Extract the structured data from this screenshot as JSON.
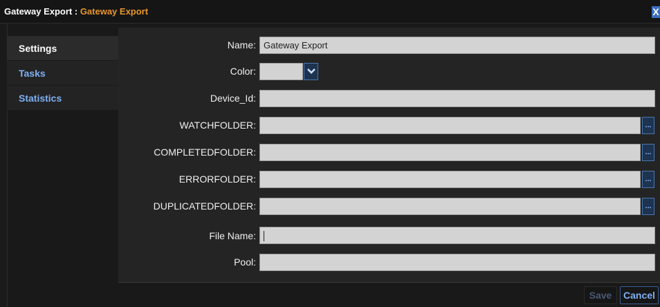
{
  "window": {
    "title_prefix": "Gateway Export : ",
    "title_name": "Gateway Export",
    "close_label": "X"
  },
  "sidebar": {
    "items": [
      {
        "label": "Settings",
        "active": true
      },
      {
        "label": "Tasks",
        "active": false
      },
      {
        "label": "Statistics",
        "active": false
      }
    ]
  },
  "form": {
    "name": {
      "label": "Name:",
      "value": "Gateway Export"
    },
    "color": {
      "label": "Color:",
      "value": ""
    },
    "device_id": {
      "label": "Device_Id:",
      "value": ""
    },
    "watchfolder": {
      "label": "WATCHFOLDER:",
      "value": ""
    },
    "completedfolder": {
      "label": "COMPLETEDFOLDER:",
      "value": ""
    },
    "errorfolder": {
      "label": "ERRORFOLDER:",
      "value": ""
    },
    "duplicatedfolder": {
      "label": "DUPLICATEDFOLDER:",
      "value": ""
    },
    "file_name": {
      "label": "File Name:",
      "value": ""
    },
    "pool": {
      "label": "Pool:",
      "value": ""
    },
    "browse_label": "..."
  },
  "footer": {
    "save_label": "Save",
    "cancel_label": "Cancel"
  },
  "colors": {
    "title_accent": "#e8962e",
    "link_blue": "#7fb0f3",
    "field_bg": "#d3d3d3",
    "panel_bg": "#242424"
  },
  "icons": {
    "close": "close-icon",
    "dropdown": "chevron-down-icon",
    "browse": "ellipsis-icon"
  }
}
